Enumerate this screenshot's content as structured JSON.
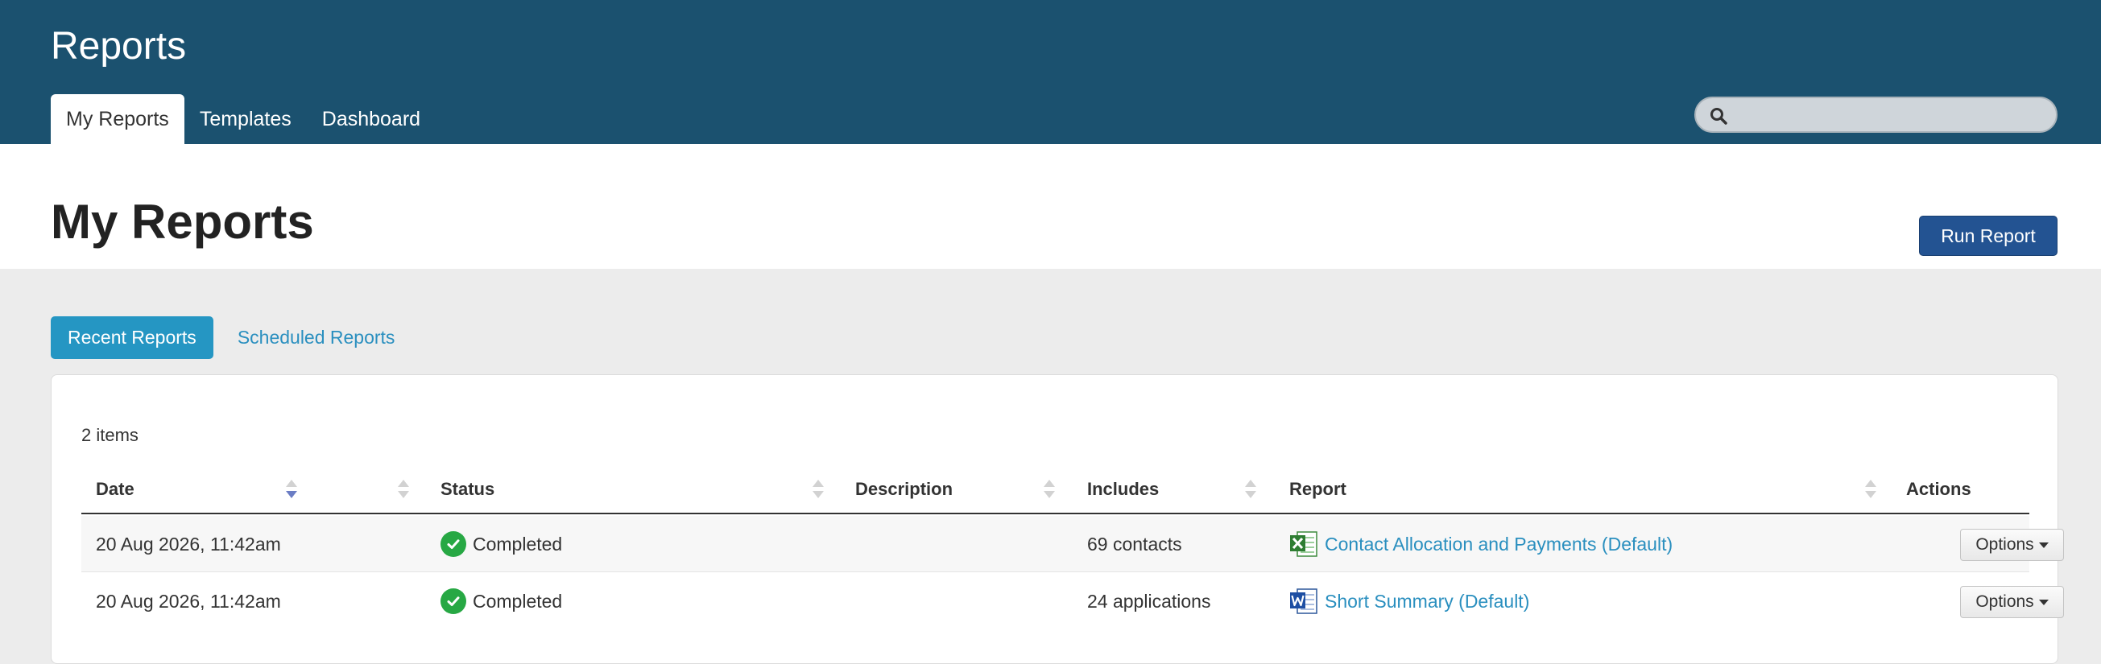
{
  "app": {
    "title": "Reports"
  },
  "nav": {
    "tabs": [
      {
        "label": "My Reports",
        "active": true
      },
      {
        "label": "Templates",
        "active": false
      },
      {
        "label": "Dashboard",
        "active": false
      }
    ]
  },
  "search": {
    "placeholder": "",
    "value": "",
    "icon": "search-icon"
  },
  "page": {
    "title": "My Reports",
    "run_button": "Run Report"
  },
  "subtabs": [
    {
      "label": "Recent Reports",
      "active": true
    },
    {
      "label": "Scheduled Reports",
      "active": false
    }
  ],
  "table": {
    "item_count": "2 items",
    "columns": {
      "date": "Date",
      "status": "Status",
      "description": "Description",
      "includes": "Includes",
      "report": "Report",
      "actions": "Actions"
    },
    "sort": {
      "column": "date",
      "direction": "descending"
    },
    "rows": [
      {
        "date": "20 Aug 2026, 11:42am",
        "status": "Completed",
        "description": "",
        "includes": "69 contacts",
        "report": "Contact Allocation and Payments (Default)",
        "report_icon": "excel-file-icon",
        "action": "Options"
      },
      {
        "date": "20 Aug 2026, 11:42am",
        "status": "Completed",
        "description": "",
        "includes": "24 applications",
        "report": "Short Summary (Default)",
        "report_icon": "word-file-icon",
        "action": "Options"
      }
    ]
  },
  "colors": {
    "header_bg": "#1b516f",
    "primary_button": "#235392",
    "active_subtab": "#2596c3",
    "link": "#2a8fbf",
    "success": "#27a844"
  }
}
